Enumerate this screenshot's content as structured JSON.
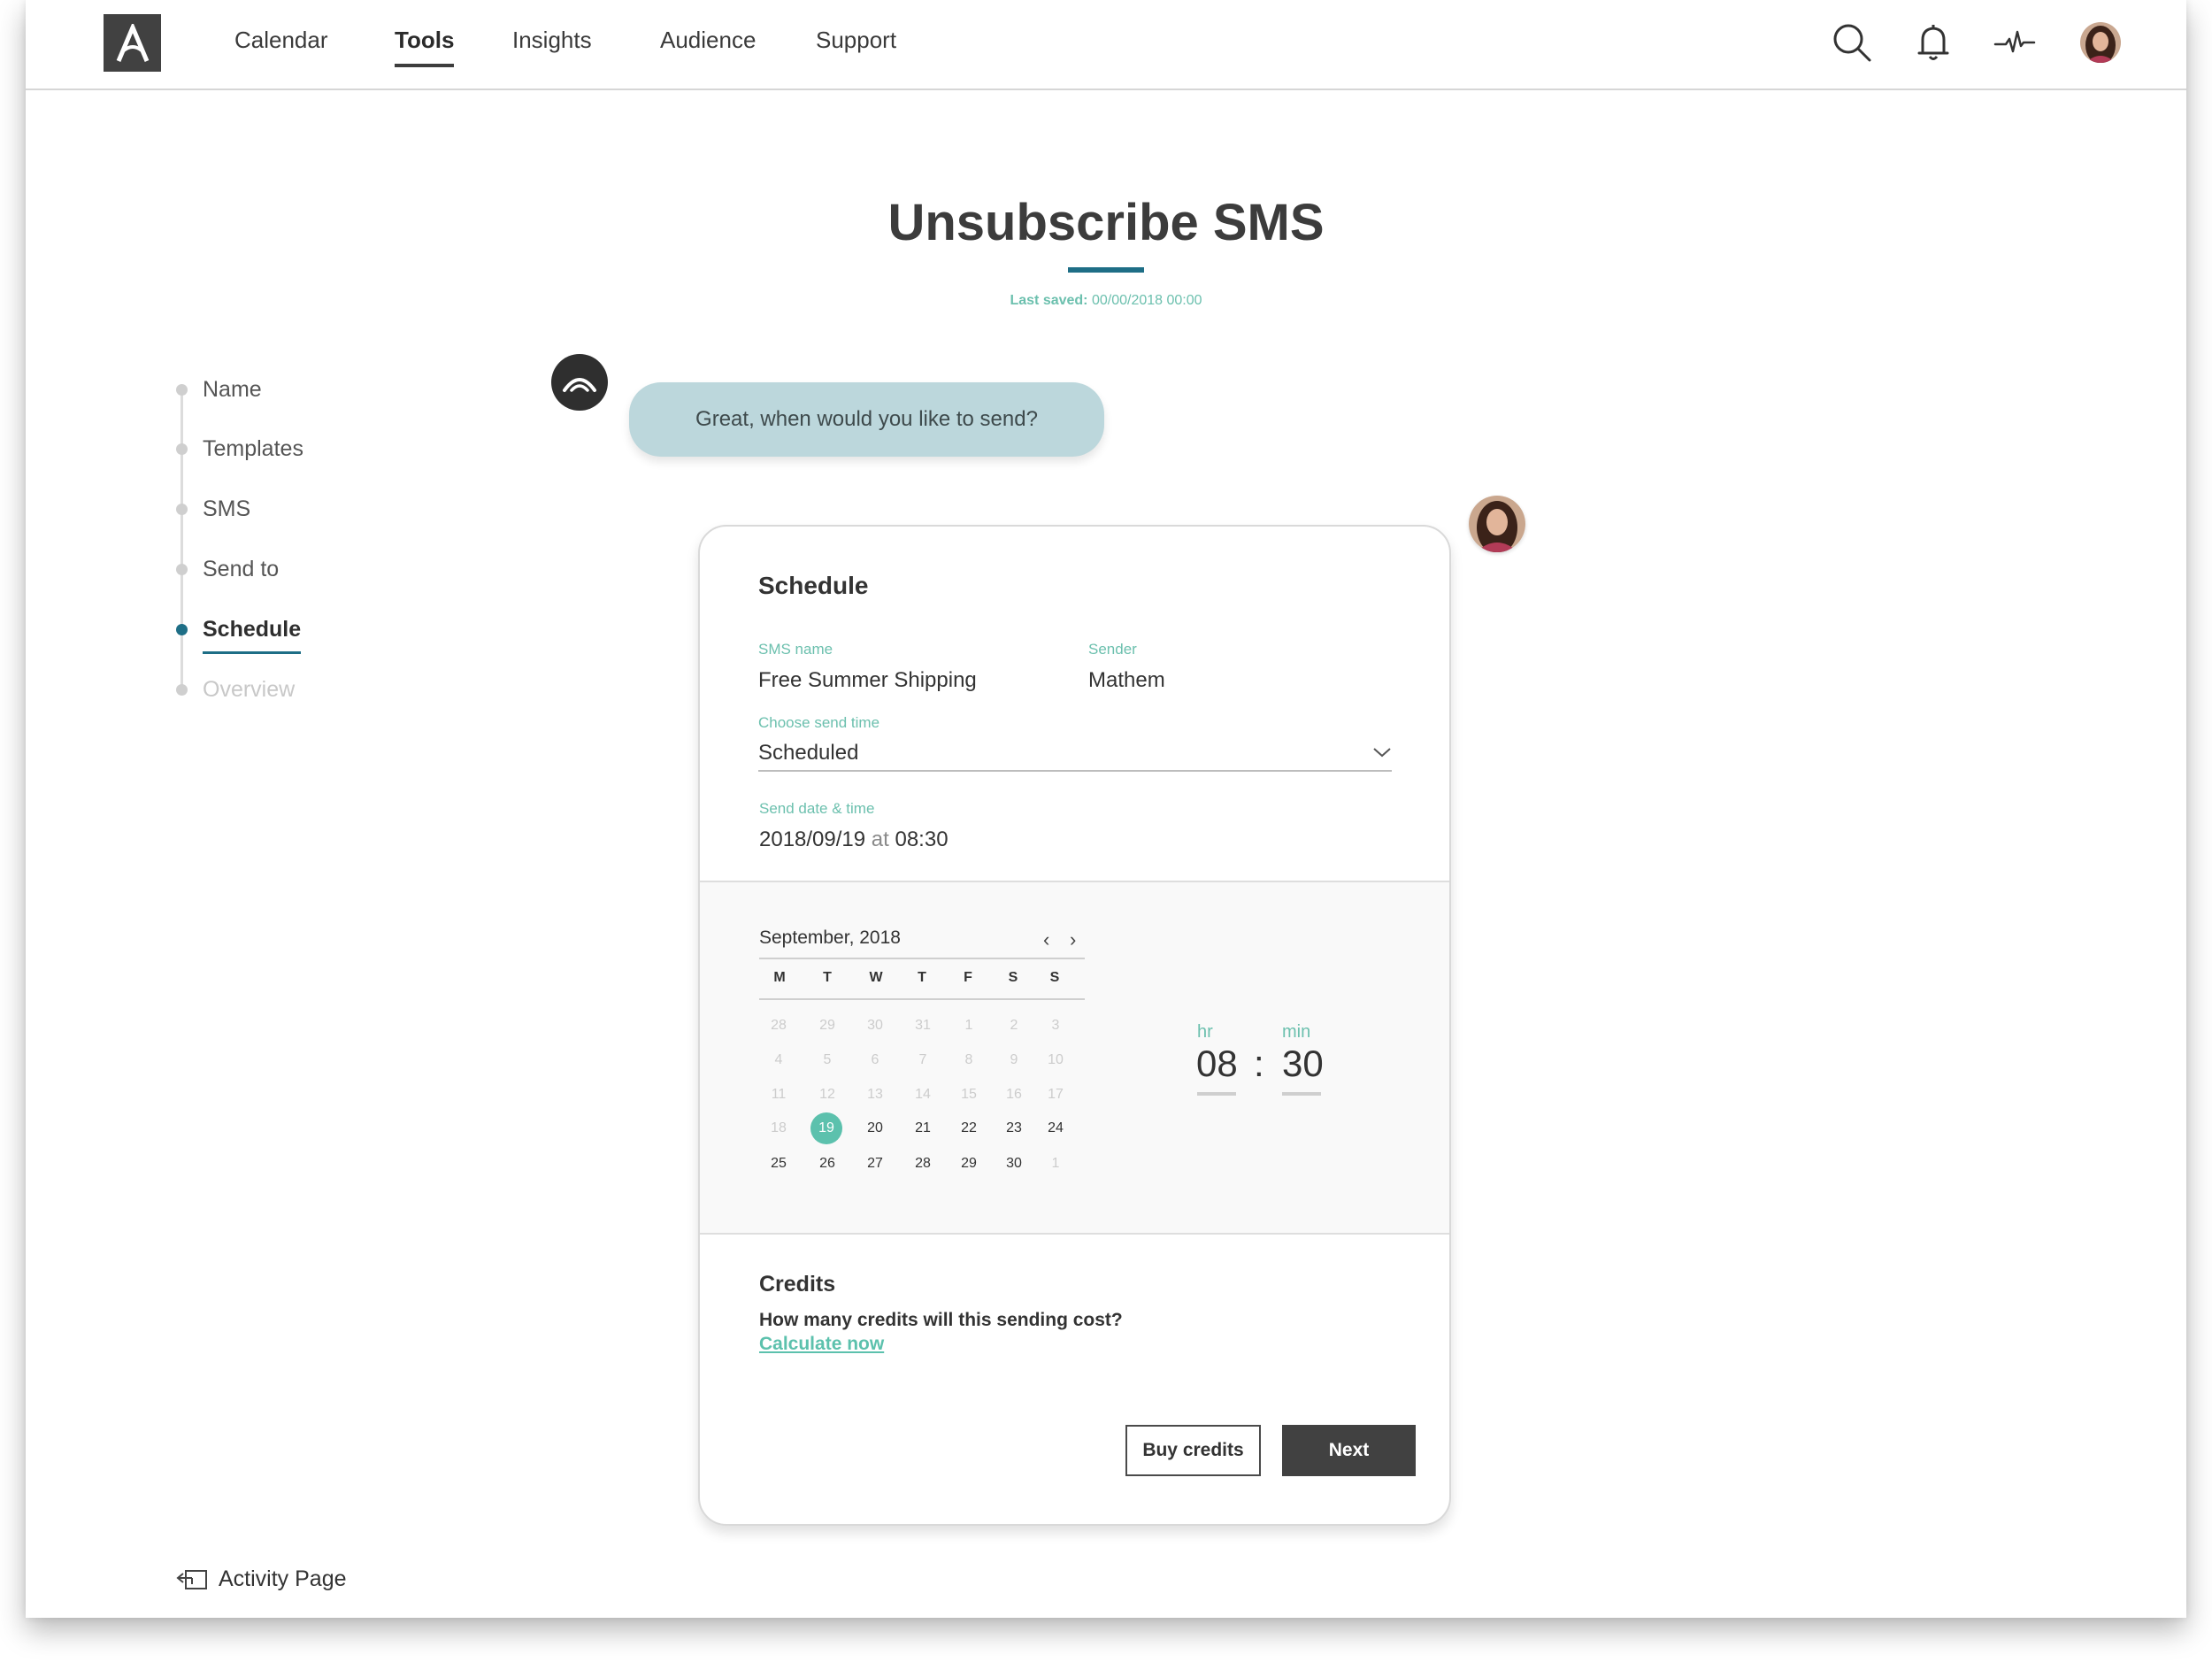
{
  "nav": {
    "items": [
      {
        "label": "Calendar"
      },
      {
        "label": "Tools",
        "active": true
      },
      {
        "label": "Insights"
      },
      {
        "label": "Audience"
      },
      {
        "label": "Support"
      }
    ],
    "icons": [
      "search-icon",
      "bell-icon",
      "activity-pulse-icon",
      "user-avatar"
    ]
  },
  "header": {
    "title": "Unsubscribe SMS",
    "last_saved_label": "Last saved:",
    "last_saved_value": "00/00/2018  00:00"
  },
  "stepper": {
    "steps": [
      {
        "label": "Name",
        "state": "done"
      },
      {
        "label": "Templates",
        "state": "done"
      },
      {
        "label": "SMS",
        "state": "done"
      },
      {
        "label": "Send to",
        "state": "done"
      },
      {
        "label": "Schedule",
        "state": "active"
      },
      {
        "label": "Overview",
        "state": "disabled"
      }
    ]
  },
  "chat": {
    "bot_message": "Great, when would you like to send?"
  },
  "schedule": {
    "title": "Schedule",
    "sms_name_label": "SMS name",
    "sms_name_value": "Free Summer Shipping",
    "sender_label": "Sender",
    "sender_value": "Mathem",
    "send_time_label": "Choose send time",
    "send_time_value": "Scheduled",
    "send_datetime_label": "Send date & time",
    "send_date": "2018/09/19",
    "send_at": "at",
    "send_time": "08:30"
  },
  "calendar": {
    "month_label": "September, 2018",
    "weekdays": [
      "M",
      "T",
      "W",
      "T",
      "F",
      "S",
      "S"
    ],
    "weeks": [
      [
        "28",
        "29",
        "30",
        "31",
        "1",
        "2",
        "3"
      ],
      [
        "4",
        "5",
        "6",
        "7",
        "8",
        "9",
        "10"
      ],
      [
        "11",
        "12",
        "13",
        "14",
        "15",
        "16",
        "17"
      ],
      [
        "18",
        "19",
        "20",
        "21",
        "22",
        "23",
        "24"
      ],
      [
        "25",
        "26",
        "27",
        "28",
        "29",
        "30",
        "1"
      ]
    ],
    "selected_day": "19"
  },
  "time": {
    "hr_label": "hr",
    "min_label": "min",
    "hr_value": "08",
    "min_value": "30",
    "separator": ":"
  },
  "credits": {
    "title": "Credits",
    "question": "How many credits will this sending cost?",
    "link": "Calculate now"
  },
  "buttons": {
    "buy_credits": "Buy credits",
    "next": "Next"
  },
  "footer": {
    "activity_link": "Activity Page"
  },
  "colors": {
    "accent_teal": "#5cc1ad",
    "accent_blue": "#1e6e86",
    "dark": "#414141",
    "bubble": "#bcd7dc"
  }
}
